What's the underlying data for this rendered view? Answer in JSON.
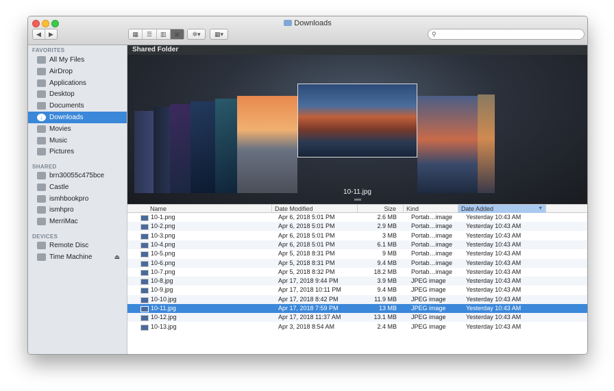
{
  "window": {
    "title": "Downloads"
  },
  "toolbar": {
    "back_icon": "chevron-left-icon",
    "forward_icon": "chevron-right-icon",
    "view_modes": [
      "icon-view-icon",
      "list-view-icon",
      "column-view-icon",
      "coverflow-view-icon"
    ],
    "action_icon": "gear-icon",
    "arrange_icon": "arrange-grid-icon",
    "search_placeholder": ""
  },
  "sidebar": {
    "favorites_heading": "FAVORITES",
    "favorites": [
      {
        "label": "All My Files",
        "icon": "all-files-icon"
      },
      {
        "label": "AirDrop",
        "icon": "airdrop-icon"
      },
      {
        "label": "Applications",
        "icon": "applications-icon"
      },
      {
        "label": "Desktop",
        "icon": "desktop-icon"
      },
      {
        "label": "Documents",
        "icon": "documents-icon"
      },
      {
        "label": "Downloads",
        "icon": "downloads-icon"
      },
      {
        "label": "Movies",
        "icon": "movies-icon"
      },
      {
        "label": "Music",
        "icon": "music-icon"
      },
      {
        "label": "Pictures",
        "icon": "pictures-icon"
      }
    ],
    "shared_heading": "SHARED",
    "shared": [
      {
        "label": "brn30055c475bce",
        "icon": "printer-share-icon"
      },
      {
        "label": "Castle",
        "icon": "network-drive-icon"
      },
      {
        "label": "ismhbookpro",
        "icon": "laptop-icon"
      },
      {
        "label": "ismhpro",
        "icon": "monitor-icon"
      },
      {
        "label": "MerriMac",
        "icon": "monitor-icon"
      }
    ],
    "devices_heading": "DEVICES",
    "devices": [
      {
        "label": "Remote Disc",
        "icon": "disc-icon"
      },
      {
        "label": "Time Machine",
        "icon": "time-machine-icon"
      }
    ]
  },
  "coverflow": {
    "header": "Shared Folder",
    "caption": "10-11.jpg"
  },
  "list": {
    "columns": {
      "name": "Name",
      "date_modified": "Date Modified",
      "size": "Size",
      "kind": "Kind",
      "date_added": "Date Added"
    },
    "rows": [
      {
        "name": "10-1.png",
        "modified": "Apr 6, 2018 5:01 PM",
        "size": "2.6 MB",
        "kind": "Portab…image",
        "added": "Yesterday 10:43 AM"
      },
      {
        "name": "10-2.png",
        "modified": "Apr 6, 2018 5:01 PM",
        "size": "2.9 MB",
        "kind": "Portab…image",
        "added": "Yesterday 10:43 AM"
      },
      {
        "name": "10-3.png",
        "modified": "Apr 6, 2018 5:01 PM",
        "size": "3 MB",
        "kind": "Portab…image",
        "added": "Yesterday 10:43 AM"
      },
      {
        "name": "10-4.png",
        "modified": "Apr 6, 2018 5:01 PM",
        "size": "6.1 MB",
        "kind": "Portab…image",
        "added": "Yesterday 10:43 AM"
      },
      {
        "name": "10-5.png",
        "modified": "Apr 5, 2018 8:31 PM",
        "size": "9 MB",
        "kind": "Portab…image",
        "added": "Yesterday 10:43 AM"
      },
      {
        "name": "10-6.png",
        "modified": "Apr 5, 2018 8:31 PM",
        "size": "9.4 MB",
        "kind": "Portab…image",
        "added": "Yesterday 10:43 AM"
      },
      {
        "name": "10-7.png",
        "modified": "Apr 5, 2018 8:32 PM",
        "size": "18.2 MB",
        "kind": "Portab…image",
        "added": "Yesterday 10:43 AM"
      },
      {
        "name": "10-8.jpg",
        "modified": "Apr 17, 2018 9:44 PM",
        "size": "3.9 MB",
        "kind": "JPEG image",
        "added": "Yesterday 10:43 AM"
      },
      {
        "name": "10-9.jpg",
        "modified": "Apr 17, 2018 10:11 PM",
        "size": "9.4 MB",
        "kind": "JPEG image",
        "added": "Yesterday 10:43 AM"
      },
      {
        "name": "10-10.jpg",
        "modified": "Apr 17, 2018 8:42 PM",
        "size": "11.9 MB",
        "kind": "JPEG image",
        "added": "Yesterday 10:43 AM"
      },
      {
        "name": "10-11.jpg",
        "modified": "Apr 17, 2018 7:59 PM",
        "size": "13 MB",
        "kind": "JPEG image",
        "added": "Yesterday 10:43 AM",
        "selected": true
      },
      {
        "name": "10-12.jpg",
        "modified": "Apr 17, 2018 11:37 AM",
        "size": "13.1 MB",
        "kind": "JPEG image",
        "added": "Yesterday 10:43 AM"
      },
      {
        "name": "10-13.jpg",
        "modified": "Apr 3, 2018 8:54 AM",
        "size": "2.4 MB",
        "kind": "JPEG image",
        "added": "Yesterday 10:43 AM"
      }
    ]
  }
}
